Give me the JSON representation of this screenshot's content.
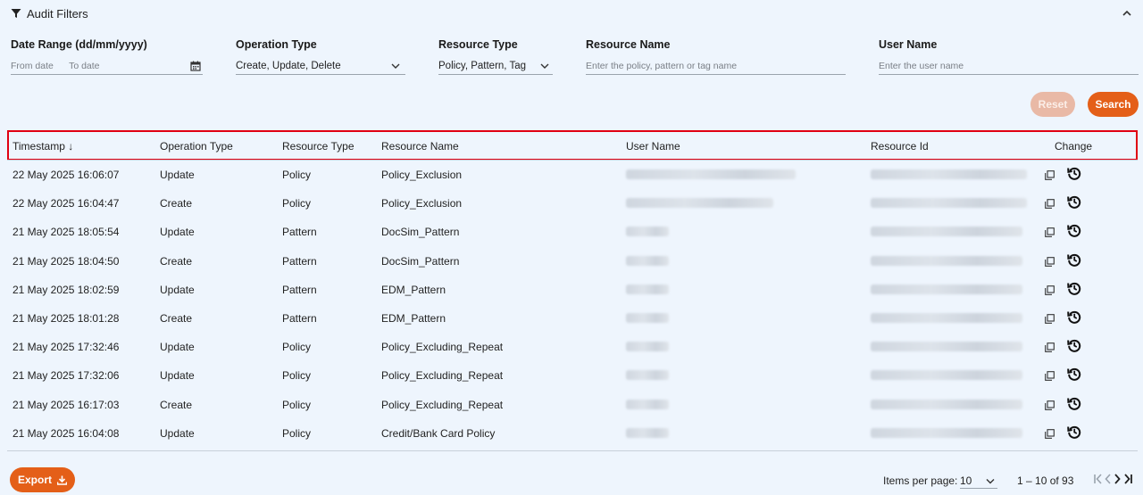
{
  "filters_header": {
    "title": "Audit Filters"
  },
  "filters": {
    "date_range": {
      "label": "Date Range (dd/mm/yyyy)",
      "from_placeholder": "From date",
      "to_placeholder": "To date"
    },
    "operation_type": {
      "label": "Operation Type",
      "value": "Create, Update, Delete"
    },
    "resource_type": {
      "label": "Resource Type",
      "value": "Policy, Pattern, Tag"
    },
    "resource_name": {
      "label": "Resource Name",
      "placeholder": "Enter the policy, pattern or tag name"
    },
    "user_name": {
      "label": "User Name",
      "placeholder": "Enter the user name"
    }
  },
  "actions": {
    "reset_label": "Reset",
    "search_label": "Search"
  },
  "table": {
    "columns": [
      "Timestamp",
      "Operation Type",
      "Resource Type",
      "Resource Name",
      "User Name",
      "Resource Id",
      "Change"
    ],
    "sort_indicator": "↓",
    "rows": [
      {
        "timestamp": "22 May 2025 16:06:07",
        "operation": "Update",
        "resource_type": "Policy",
        "resource_name": "Policy_Exclusion"
      },
      {
        "timestamp": "22 May 2025 16:04:47",
        "operation": "Create",
        "resource_type": "Policy",
        "resource_name": "Policy_Exclusion"
      },
      {
        "timestamp": "21 May 2025 18:05:54",
        "operation": "Update",
        "resource_type": "Pattern",
        "resource_name": "DocSim_Pattern"
      },
      {
        "timestamp": "21 May 2025 18:04:50",
        "operation": "Create",
        "resource_type": "Pattern",
        "resource_name": "DocSim_Pattern"
      },
      {
        "timestamp": "21 May 2025 18:02:59",
        "operation": "Update",
        "resource_type": "Pattern",
        "resource_name": "EDM_Pattern"
      },
      {
        "timestamp": "21 May 2025 18:01:28",
        "operation": "Create",
        "resource_type": "Pattern",
        "resource_name": "EDM_Pattern"
      },
      {
        "timestamp": "21 May 2025 17:32:46",
        "operation": "Update",
        "resource_type": "Policy",
        "resource_name": "Policy_Excluding_Repeat"
      },
      {
        "timestamp": "21 May 2025 17:32:06",
        "operation": "Update",
        "resource_type": "Policy",
        "resource_name": "Policy_Excluding_Repeat"
      },
      {
        "timestamp": "21 May 2025 16:17:03",
        "operation": "Create",
        "resource_type": "Policy",
        "resource_name": "Policy_Excluding_Repeat"
      },
      {
        "timestamp": "21 May 2025 16:04:08",
        "operation": "Update",
        "resource_type": "Policy",
        "resource_name": "Credit/Bank Card Policy"
      }
    ]
  },
  "footer": {
    "export_label": "Export",
    "items_per_page_label": "Items per page:",
    "items_per_page_value": "10",
    "range_label": "1 – 10 of 93"
  },
  "icons": {
    "filter": "funnel-icon",
    "collapse": "chevron-up-icon",
    "calendar": "calendar-icon",
    "dropdown": "chevron-down-icon",
    "copy": "copy-icon",
    "change": "history-icon",
    "export": "download-icon",
    "first": "first-page-icon",
    "prev": "prev-page-icon",
    "next": "next-page-icon",
    "last": "last-page-icon"
  },
  "colors": {
    "accent": "#e45f18",
    "reset_disabled": "#e9b9a6",
    "highlight": "#e00012",
    "background": "#eef5fd"
  }
}
